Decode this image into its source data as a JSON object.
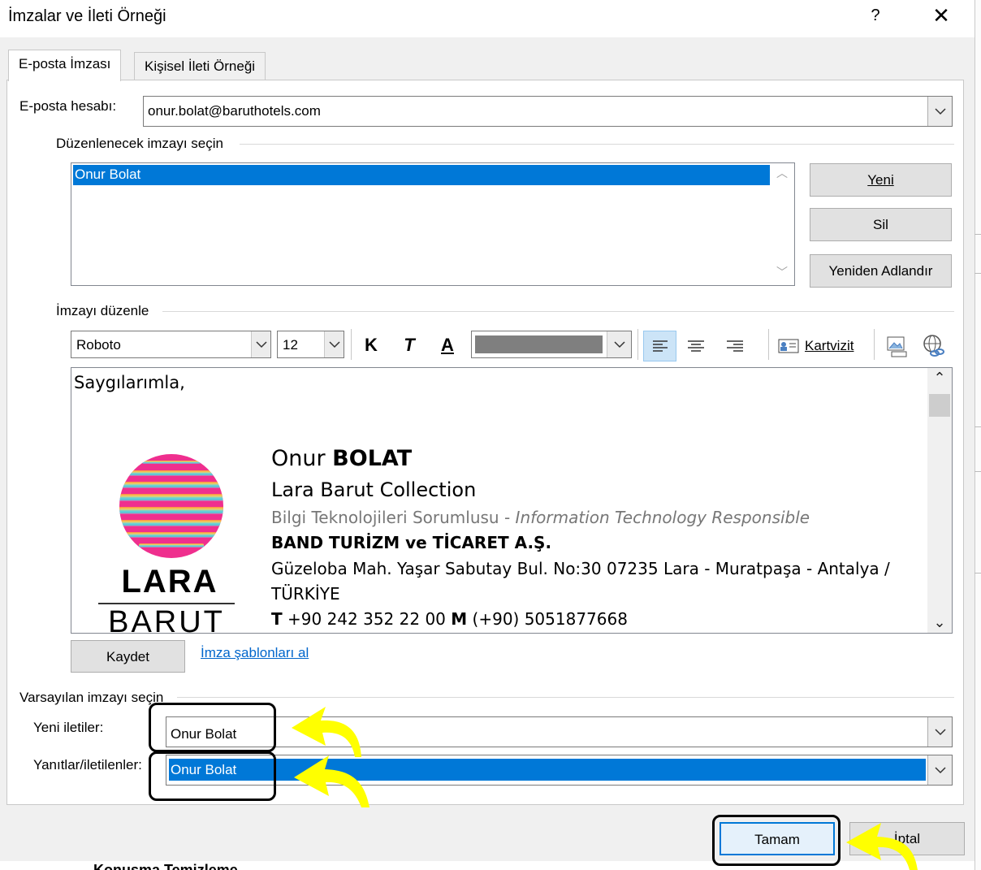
{
  "window": {
    "title": "İmzalar ve İleti Örneği",
    "help": "?",
    "close": "✕"
  },
  "tabs": [
    {
      "label": "E-posta İmzası",
      "active": true
    },
    {
      "label": "Kişisel İleti Örneği",
      "active": false
    }
  ],
  "account": {
    "label": "E-posta hesabı:",
    "value": "onur.bolat@baruthotels.com"
  },
  "select_section": {
    "label": "Düzenlenecek imzayı seçin",
    "items": [
      "Onur Bolat"
    ]
  },
  "buttons": {
    "new": "Yeni",
    "delete": "Sil",
    "rename": "Yeniden Adlandır",
    "save": "Kaydet",
    "ok": "Tamam",
    "cancel": "İptal"
  },
  "edit_section": {
    "label": "İmzayı düzenle"
  },
  "toolbar": {
    "font": "Roboto",
    "size": "12",
    "bold": "K",
    "italic": "T",
    "underline": "A",
    "business_card": "Kartvizit"
  },
  "signature": {
    "greeting": "Saygılarımla,",
    "name_first": "Onur ",
    "name_last": "BOLAT",
    "hotel": "Lara Barut Collection",
    "title_tr": "Bilgi Teknolojileri Sorumlusu - ",
    "title_en": "Information Technology Responsible",
    "company": "BAND TURİZM ve TİCARET A.Ş.",
    "address1": "Güzeloba Mah. Yaşar Sabutay Bul. No:30 07235 Lara - Muratpaşa - Antalya /",
    "address2": "TÜRKİYE",
    "phone_label": "T",
    "phone": " +90 242 352 22 00 ",
    "mobile_label": "M",
    "mobile": " (+90) 5051877668",
    "logo_line1": "LARA",
    "logo_line2": "BARUT"
  },
  "templates_link": "İmza şablonları al",
  "defaults": {
    "label": "Varsayılan imzayı seçin",
    "new_messages_label": "Yeni iletiler:",
    "new_messages_value": "Onur Bolat",
    "replies_label": "Yanıtlar/iletilenler:",
    "replies_value": "Onur Bolat"
  },
  "behind_text": "Konuşma Temizleme",
  "colors": {
    "selection": "#0078d7",
    "highlight_arrow": "#ffff00"
  }
}
